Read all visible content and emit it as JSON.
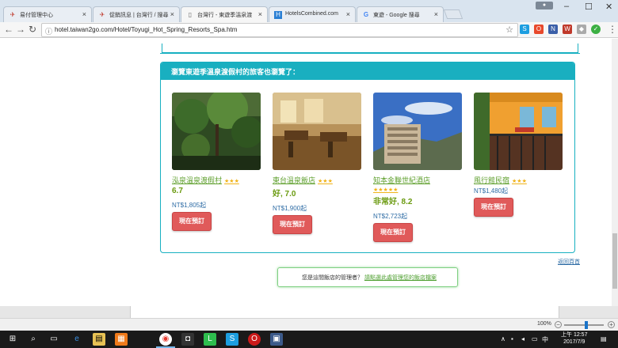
{
  "browser": {
    "tabs": [
      {
        "title": "易付管理中心",
        "favicon": "易遊網-icon",
        "active": false
      },
      {
        "title": "促銷訊息 | 台灣行 / 搜尋",
        "favicon": "易遊網-icon",
        "active": false
      },
      {
        "title": "台灣行 - 東遊季溫泉渡",
        "favicon": "page-icon",
        "active": true
      },
      {
        "title": "HotelsCombined.com",
        "favicon": "hotelscombined-icon",
        "active": false
      },
      {
        "title": "東遊 - Google 搜尋",
        "favicon": "google-icon",
        "active": false
      }
    ],
    "url": "hotel.taiwan2go.com/Hotel/Toyugi_Hot_Spring_Resorts_Spa.htm",
    "zoom": "100%"
  },
  "section": {
    "heading": "瀏覽東遊季溫泉渡假村的旅客也瀏覽了："
  },
  "hotels": [
    {
      "name": "泓泉溫泉渡假村",
      "stars": "★★★",
      "score": "6.7",
      "price": "NT$1,805起",
      "book": "現在預訂"
    },
    {
      "name": "東台溫泉飯店",
      "stars": "★★★",
      "score": "好, 7.0",
      "price": "NT$1,900起",
      "book": "現在預訂"
    },
    {
      "name": "知本金聯世紀酒店",
      "stars": "★★★★★",
      "score": "非常好, 8.2",
      "price": "NT$2,723起",
      "book": "現在預訂"
    },
    {
      "name": "風行館民宿",
      "stars": "★★★",
      "score": "",
      "price": "NT$1,480起",
      "book": "現在預訂"
    }
  ],
  "back_to_top": "返回頁首",
  "owner_prompt": {
    "text": "您是這間飯店的管理者？",
    "link": "請點選此處管理您的飯店檔案"
  },
  "taskbar": {
    "time": "上午 12:57",
    "date": "2017/7/9"
  }
}
